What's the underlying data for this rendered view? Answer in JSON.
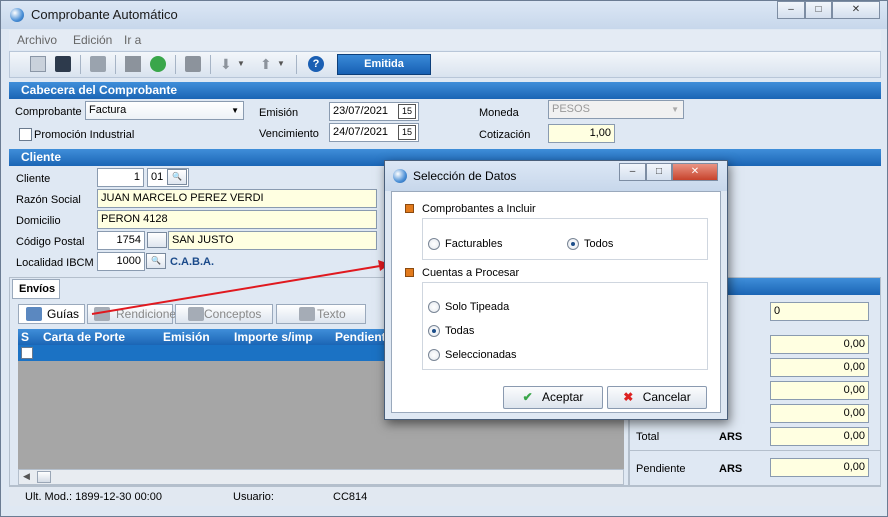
{
  "window": {
    "title": "Comprobante Automático",
    "min": "‒",
    "max": "□",
    "close": "✕"
  },
  "menu": [
    {
      "label": "Archivo"
    },
    {
      "label": "Edición"
    },
    {
      "label": "Ir a"
    }
  ],
  "toolbar": {
    "status_label": "Emitida"
  },
  "cabecera": {
    "title": "Cabecera del Comprobante",
    "comprobante_label": "Comprobante",
    "comprobante_value": "Factura",
    "promocion_label": "Promoción Industrial",
    "emision_label": "Emisión",
    "emision_value": "23/07/2021",
    "vencimiento_label": "Vencimiento",
    "vencimiento_value": "24/07/2021",
    "moneda_label": "Moneda",
    "moneda_value": "PESOS",
    "cotizacion_label": "Cotización",
    "cotizacion_value": "1,00"
  },
  "cliente": {
    "title": "Cliente",
    "cliente_label": "Cliente",
    "cliente_num": "1",
    "cliente_suc": "01",
    "razon_label": "Razón Social",
    "razon_value": "JUAN MARCELO PEREZ VERDI",
    "domicilio_label": "Domicilio",
    "domicilio_value": "PERON 4128",
    "cp_label": "Código Postal",
    "cp_value": "1754",
    "cp_localidad": "SAN JUSTO",
    "localidad_label": "Localidad IBCM",
    "localidad_value": "1000",
    "localidad_name": "C.A.B.A."
  },
  "envios": {
    "tab_label": "Envíos",
    "subtabs": [
      {
        "label": "Guías"
      },
      {
        "label": "Rendiciones"
      },
      {
        "label": "Conceptos"
      },
      {
        "label": "Texto"
      }
    ],
    "columns": [
      {
        "label": "S"
      },
      {
        "label": "Carta de Porte"
      },
      {
        "label": "Emisión"
      },
      {
        "label": "Importe s/imp"
      },
      {
        "label": "Pendient"
      }
    ]
  },
  "totals": {
    "top_value": "0",
    "values": [
      "0,00",
      "0,00",
      "0,00",
      "0,00"
    ],
    "total_label": "Total",
    "total_currency": "ARS",
    "total_value": "0,00",
    "pendiente_label": "Pendiente",
    "pendiente_currency": "ARS",
    "pendiente_value": "0,00"
  },
  "status": {
    "ult_mod": "Ult. Mod.: 1899-12-30 00:00",
    "usuario_label": "Usuario:",
    "usuario_value": "CC814"
  },
  "dialog": {
    "title": "Selección de Datos",
    "group1_title": "Comprobantes a Incluir",
    "opt_facturables": "Facturables",
    "opt_todos": "Todos",
    "group2_title": "Cuentas a Procesar",
    "opt_solo": "Solo Tipeada",
    "opt_todas": "Todas",
    "opt_selec": "Seleccionadas",
    "accept": "Aceptar",
    "cancel": "Cancelar"
  },
  "colors": {
    "header_blue": "#1b65b5",
    "field_yellow": "#ffffe1",
    "arrow_red": "#e0191f",
    "accent_orange": "#e27a1c"
  }
}
